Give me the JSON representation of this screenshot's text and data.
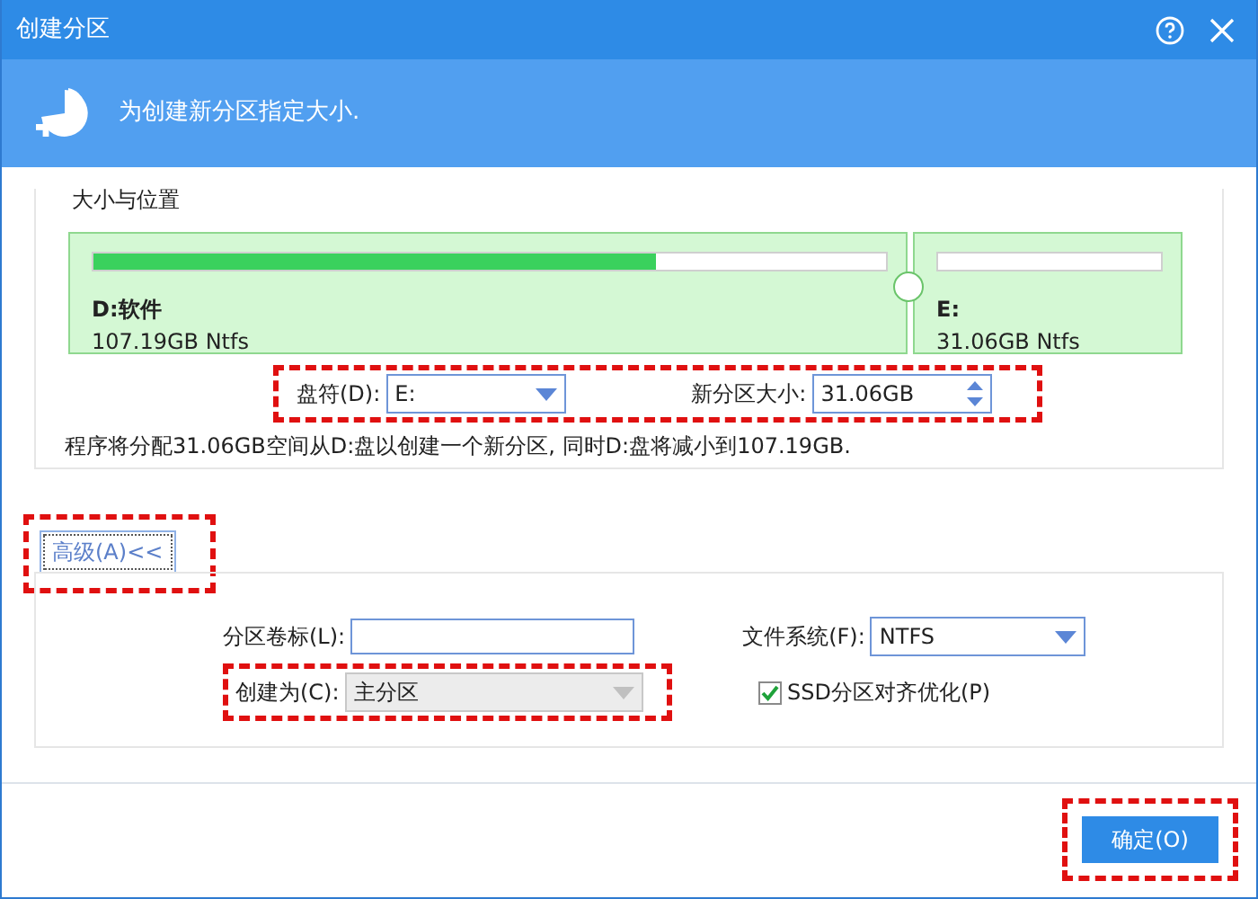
{
  "window": {
    "title": "创建分区"
  },
  "header": {
    "text": "为创建新分区指定大小."
  },
  "size_location": {
    "title": "大小与位置",
    "partitions": [
      {
        "name": "D:软件",
        "info": "107.19GB Ntfs",
        "level": 0.71
      },
      {
        "name": "E:",
        "info": "31.06GB Ntfs",
        "level": 0
      }
    ],
    "fields_highlighted": true,
    "drive_letter": {
      "label": "盘符(D):",
      "value": "E:"
    },
    "new_size": {
      "label": "新分区大小:",
      "value": "31.06GB"
    },
    "note": "程序将分配31.06GB空间从D:盘以创建一个新分区, 同时D:盘将减小到107.19GB."
  },
  "advanced": {
    "button": "高级(A)<<",
    "highlighted": true,
    "volume_label": {
      "label": "分区卷标(L):"
    },
    "file_system": {
      "label": "文件系统(F):",
      "value": "NTFS"
    },
    "create_as": {
      "label": "创建为(C):",
      "value": "主分区",
      "disabled": true,
      "highlighted": true
    },
    "ssd_align": {
      "label": "SSD分区对齐优化(P)",
      "checked": true
    }
  },
  "ok_button": {
    "label": "确定(O)",
    "highlighted": true
  }
}
